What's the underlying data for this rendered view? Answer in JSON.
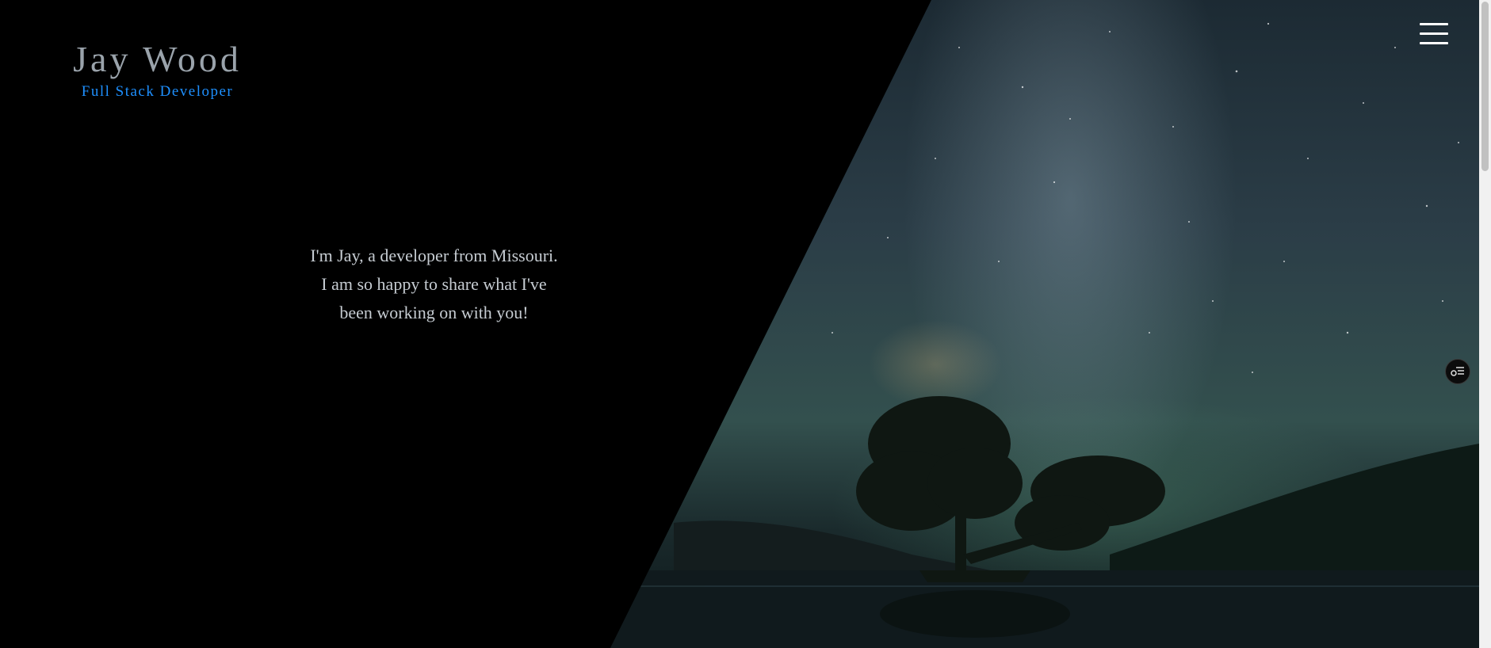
{
  "header": {
    "name": "Jay Wood",
    "role": "Full Stack Developer"
  },
  "intro": {
    "lines": [
      "I'm Jay, a developer from Missouri.",
      "I am so happy to share what I've",
      "been working on with you!"
    ]
  },
  "icons": {
    "menu": "hamburger-menu-icon",
    "floating_tool": "toggle-list-icon"
  },
  "colors": {
    "background": "#000000",
    "name": "#9aa3ab",
    "role": "#1e90ff",
    "intro_text": "#c6ccd2",
    "menu_icon": "#ffffff"
  }
}
